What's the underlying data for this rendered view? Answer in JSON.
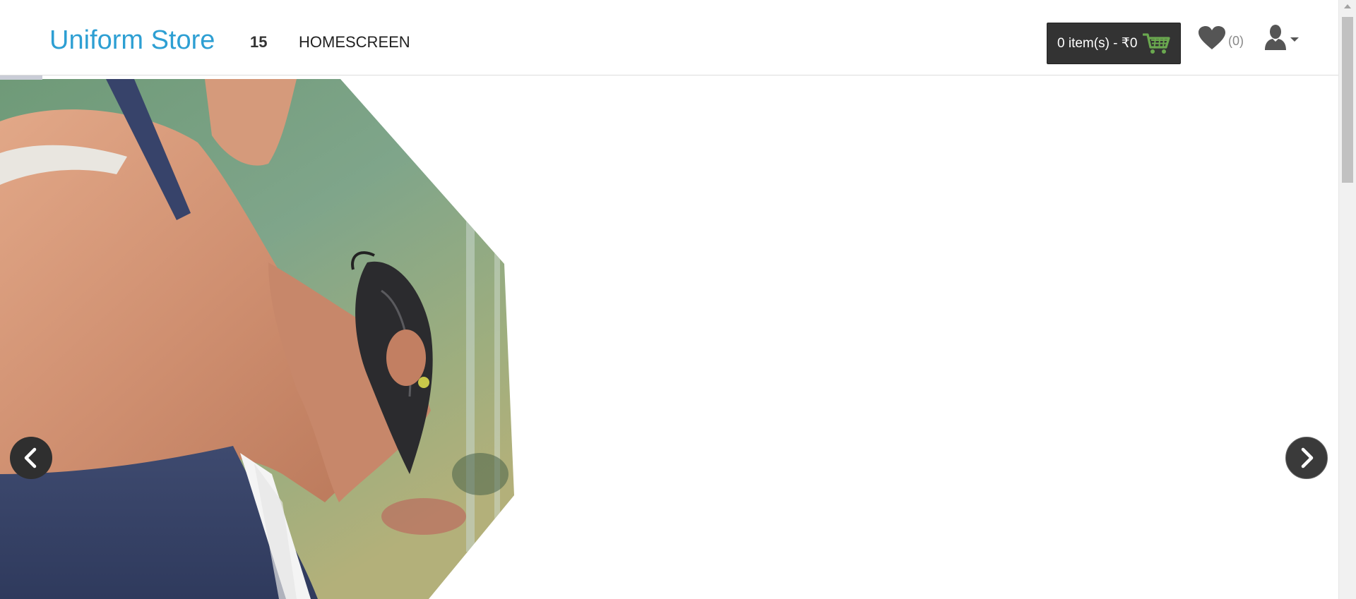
{
  "header": {
    "brand": "Uniform Store",
    "nav_number": "15",
    "nav_home": "HOMESCREEN"
  },
  "cart": {
    "label": "0 item(s) - ₹0",
    "icon": "shopping-cart-icon",
    "icon_color": "#6aa84f"
  },
  "wishlist": {
    "icon": "heart-icon",
    "count": "(0)"
  },
  "account": {
    "icon": "user-icon",
    "dropdown_icon": "caret-down-icon"
  },
  "slider": {
    "prev_icon": "chevron-left-icon",
    "next_icon": "chevron-right-icon",
    "image": "softball-player-with-glove"
  },
  "colors": {
    "brand": "#2d9fd3",
    "cart_bg": "#333333",
    "arrow_bg": "#2f2f2f"
  }
}
